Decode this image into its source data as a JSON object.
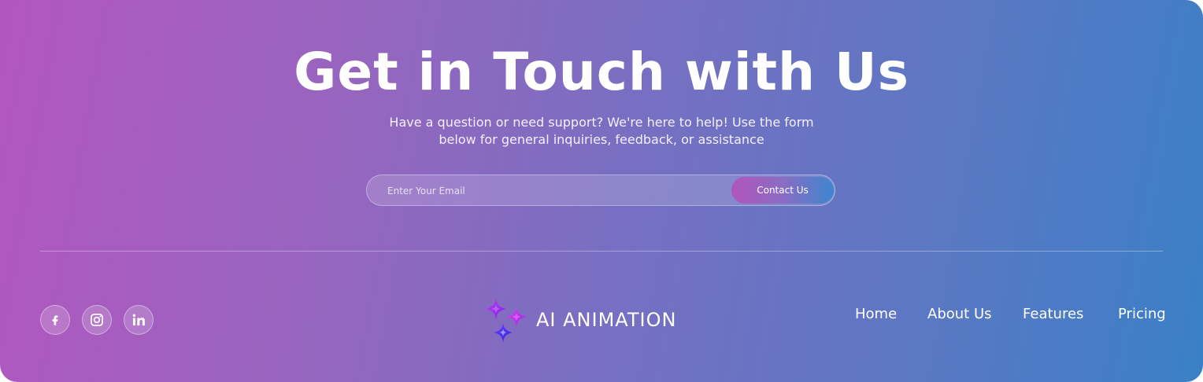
{
  "contact": {
    "headline": "Get in Touch with Us",
    "subtext_line1": "Have a question or need support? We're here to help! Use the form",
    "subtext_line2": "below for general inquiries, feedback, or assistance",
    "email_placeholder": "Enter Your Email",
    "email_value": "",
    "button_label": "Contact Us"
  },
  "footer": {
    "social_icons": [
      "facebook-icon",
      "instagram-icon",
      "linkedin-icon"
    ],
    "brand_name": "AI ANIMATION",
    "brand_icon": "sparkles-icon",
    "nav_links": [
      "Home",
      "About Us",
      "Features",
      "Pricing"
    ]
  },
  "colors": {
    "gradient_start": "#b356bf",
    "gradient_end": "#3a80c6",
    "text": "#ffffff",
    "logo_purple": "#a020f0",
    "logo_blue": "#5b2bff"
  }
}
